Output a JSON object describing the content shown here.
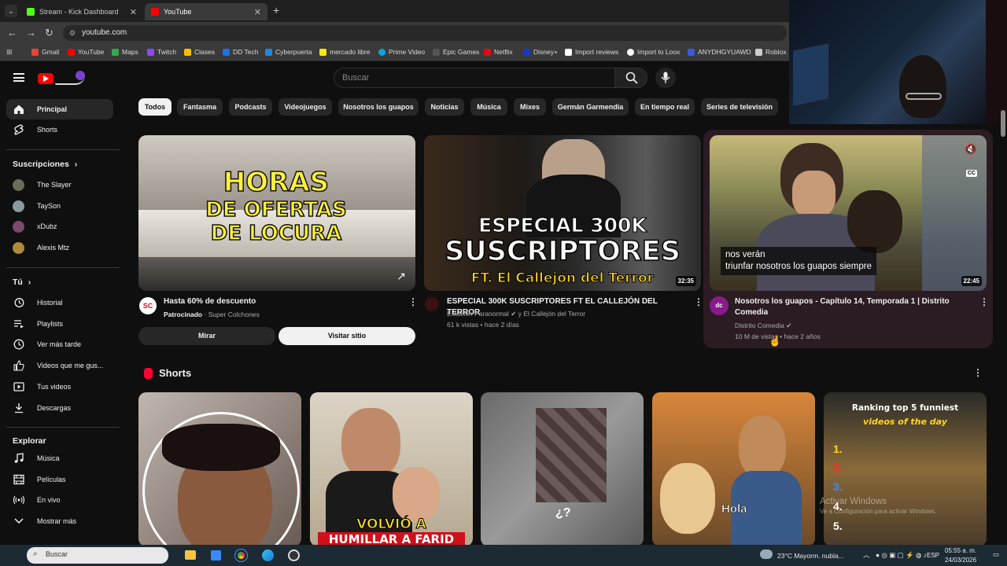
{
  "browser": {
    "tabs": [
      {
        "title": "Stream - Kick Dashboard",
        "color": "#53fc18"
      },
      {
        "title": "YouTube",
        "color": "#ff0000"
      }
    ],
    "url": "youtube.com",
    "bookmarks": [
      {
        "label": "Gmail",
        "color": "#ea4335"
      },
      {
        "label": "YouTube",
        "color": "#ff0000"
      },
      {
        "label": "Maps",
        "color": "#34a853"
      },
      {
        "label": "Twitch",
        "color": "#9146ff"
      },
      {
        "label": "Clases",
        "color": "#fbbc04"
      },
      {
        "label": "DD Tech",
        "color": "#1a73e8"
      },
      {
        "label": "Cyberpuerta",
        "color": "#1e88e5"
      },
      {
        "label": "mercado libre",
        "color": "#ffe600"
      },
      {
        "label": "Prime Video",
        "color": "#00a8e1"
      },
      {
        "label": "Epic Games",
        "color": "#555555"
      },
      {
        "label": "Netflix",
        "color": "#e50914"
      },
      {
        "label": "Disney+",
        "color": "#113ccf"
      },
      {
        "label": "Import reviews",
        "color": "#ffffff"
      },
      {
        "label": "Import to Loox",
        "color": "#ffffff"
      },
      {
        "label": "ANYDHGYUAWD",
        "color": "#3b5bdb"
      },
      {
        "label": "Roblox",
        "color": "#cccccc"
      }
    ]
  },
  "header": {
    "search_placeholder": "Buscar"
  },
  "sidebar": {
    "main": [
      {
        "label": "Principal",
        "icon": "home-icon"
      },
      {
        "label": "Shorts",
        "icon": "shorts-icon"
      }
    ],
    "subscriptions_title": "Suscripciones",
    "subscriptions": [
      {
        "label": "The Slayer",
        "color": "#6b6b5a"
      },
      {
        "label": "TaySon",
        "color": "#8a9aa0"
      },
      {
        "label": "xDubz",
        "color": "#7a4b6a"
      },
      {
        "label": "Alexis Mtz",
        "color": "#b08a3a"
      }
    ],
    "you_title": "Tú",
    "you": [
      {
        "label": "Historial",
        "icon": "history-icon"
      },
      {
        "label": "Playlists",
        "icon": "playlist-icon"
      },
      {
        "label": "Ver más tarde",
        "icon": "clock-icon"
      },
      {
        "label": "Videos que me gus...",
        "icon": "like-icon"
      },
      {
        "label": "Tus videos",
        "icon": "video-icon"
      },
      {
        "label": "Descargas",
        "icon": "download-icon"
      }
    ],
    "explore_title": "Explorar",
    "explore": [
      {
        "label": "Música",
        "icon": "music-icon"
      },
      {
        "label": "Películas",
        "icon": "film-icon"
      },
      {
        "label": "En vivo",
        "icon": "live-icon"
      },
      {
        "label": "Mostrar más",
        "icon": "chevron-down-icon"
      }
    ]
  },
  "chips": [
    "Todos",
    "Fantasma",
    "Podcasts",
    "Videojuegos",
    "Nosotros los guapos",
    "Noticias",
    "Música",
    "Mixes",
    "Germán Garmendia",
    "En tiempo real",
    "Series de televisión"
  ],
  "videos": [
    {
      "title": "Hasta 60% de descuento",
      "channel_prefix": "Patrocinado",
      "channel": "Super Colchones",
      "thumb_text_1": "HORAS",
      "thumb_text_2": "DE OFERTAS",
      "thumb_text_3": "DE LOCURA",
      "button_watch": "Mirar",
      "button_visit": "Visitar sitio",
      "avatar_text": "SC"
    },
    {
      "title": "ESPECIAL 300K SUSCRIPTORES FT EL CALLEJÓN DEL TERROR",
      "channel": "Estación Paranormal",
      "channel_suffix": "y El Callejón del Terror",
      "meta": "61 k vistas • hace 2 días",
      "duration": "32:35",
      "thumb_text_1": "ESPECIAL 300K",
      "thumb_text_2": "SUSCRIPTORES",
      "thumb_text_3": "FT. El Callejón del Terror"
    },
    {
      "title": "Nosotros los guapos - Capítulo 14, Temporada 1 | Distrito Comedia",
      "channel": "Distrito Comedia",
      "meta": "10 M de vistas • hace 2 años",
      "duration": "22:45",
      "caption_1": "nos verán",
      "caption_2": "triunfar nosotros los guapos siempre",
      "cc": "CC"
    }
  ],
  "shorts_title": "Shorts",
  "shorts": [
    {
      "overlay": ""
    },
    {
      "overlay_1": "VOLVIÓ A",
      "overlay_2": "HUMILLAR A FARID"
    },
    {
      "overlay": "¿?"
    },
    {
      "overlay": "Hola"
    },
    {
      "overlay_1": "Ranking top 5 funniest",
      "overlay_2": "videos of the day",
      "ranks": [
        "1.",
        "2.",
        "3.",
        "4.",
        "5."
      ]
    }
  ],
  "windows_watermark": {
    "title": "Activar Windows",
    "subtitle": "Ve a Configuración para activar Windows."
  },
  "taskbar": {
    "search": "Buscar",
    "weather": "23°C  Mayorm. nubla...",
    "lang": "ESP",
    "time": "05:55 a. m.",
    "date": "24/03/2026"
  }
}
